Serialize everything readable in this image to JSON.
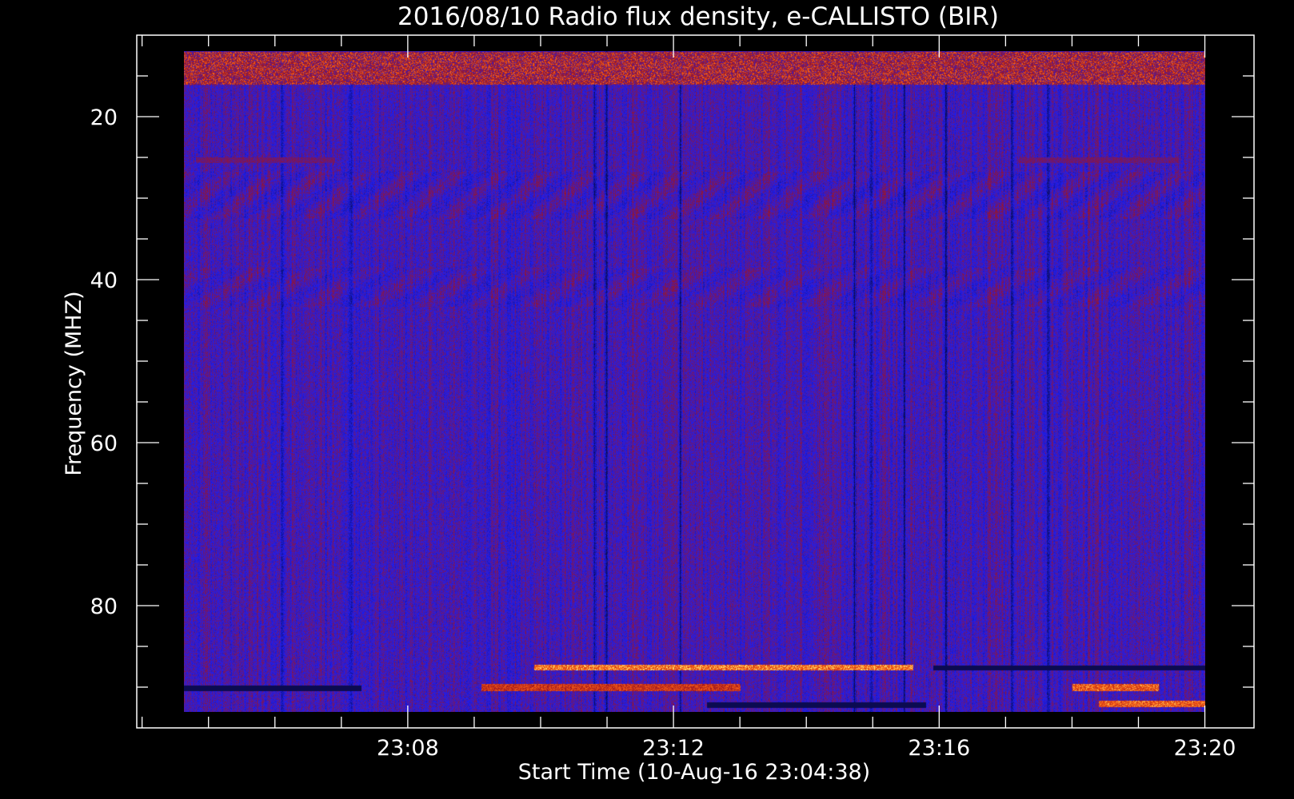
{
  "chart_data": {
    "type": "heatmap",
    "title": "2016/08/10  Radio flux density, e-CALLISTO (BIR)",
    "xlabel": "Start Time (10-Aug-16 23:04:38)",
    "ylabel": "Frequency (MHZ)",
    "x_ticks": [
      "23:08",
      "23:12",
      "23:16",
      "23:20"
    ],
    "y_ticks": [
      "20",
      "40",
      "60",
      "80"
    ],
    "x_range_minutes": [
      1384.63,
      1400.0
    ],
    "xlim_minutes": [
      1383.92,
      1400.74
    ],
    "ylim_mhz": [
      10,
      95
    ],
    "data_extent_mhz": [
      12,
      93
    ],
    "x_major_minutes": [
      1388,
      1392,
      1396,
      1400
    ],
    "x_minor_step_minutes": 1,
    "y_major_mhz": [
      20,
      40,
      60,
      80
    ],
    "y_minor_step_mhz": 5,
    "inverted_y": true,
    "colors": {
      "background": "#000000",
      "low": "#1e1ef0",
      "dark": "#0a0a46",
      "mid": "#a0141e",
      "high": "#ff6414",
      "peak": "#ffff80"
    },
    "features": [
      {
        "kind": "broadband",
        "note": "intense emission at top of band",
        "mhz": [
          12,
          16
        ],
        "intensity": 0.75
      },
      {
        "kind": "band",
        "mhz": [
          25,
          25.6
        ],
        "intensity": 0.55,
        "minutes": [
          1384.8,
          1386.9
        ]
      },
      {
        "kind": "band",
        "mhz": [
          25,
          25.6
        ],
        "intensity": 0.55,
        "minutes": [
          1397.2,
          1399.6
        ]
      },
      {
        "kind": "band",
        "mhz": [
          87.2,
          87.9
        ],
        "intensity": 0.95,
        "minutes": [
          1389.9,
          1395.6
        ]
      },
      {
        "kind": "band",
        "mhz": [
          89.6,
          90.4
        ],
        "intensity": 0.8,
        "minutes": [
          1389.1,
          1393.0
        ]
      },
      {
        "kind": "band",
        "mhz": [
          89.6,
          90.4
        ],
        "intensity": 0.9,
        "minutes": [
          1398.0,
          1399.3
        ]
      },
      {
        "kind": "band",
        "mhz": [
          91.6,
          92.4
        ],
        "intensity": 0.9,
        "minutes": [
          1398.4,
          1400.0
        ]
      },
      {
        "kind": "dark_band",
        "mhz": [
          87.3,
          87.9
        ],
        "minutes": [
          1395.9,
          1400.0
        ]
      },
      {
        "kind": "dark_band",
        "mhz": [
          89.8,
          90.4
        ],
        "minutes": [
          1384.63,
          1387.3
        ]
      },
      {
        "kind": "dark_band",
        "mhz": [
          91.8,
          92.5
        ],
        "minutes": [
          1392.5,
          1395.8
        ]
      }
    ]
  }
}
